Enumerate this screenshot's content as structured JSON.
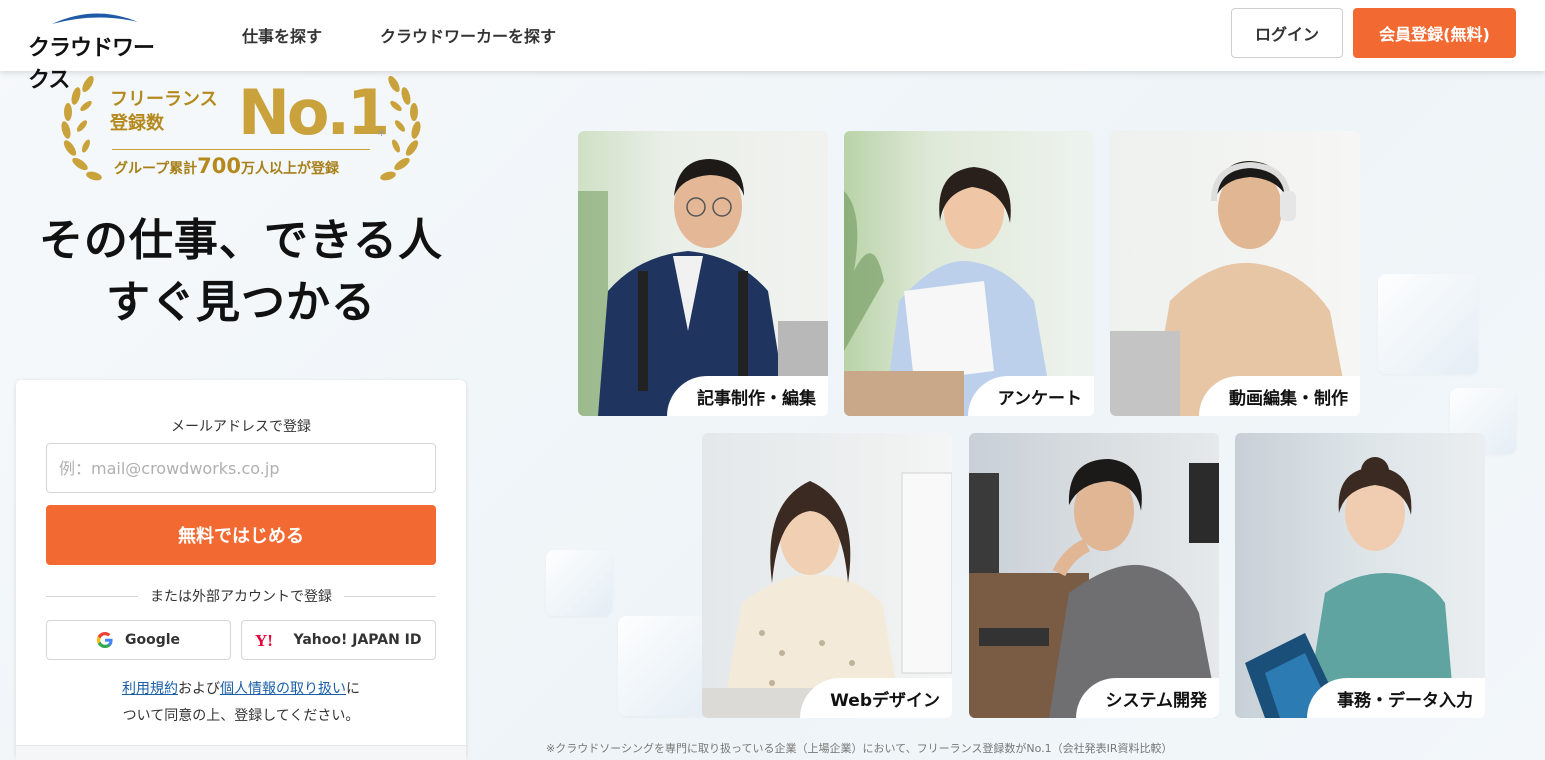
{
  "header": {
    "logo_text": "クラウドワークス",
    "nav": [
      "仕事を探す",
      "クラウドワーカーを探す"
    ],
    "login_label": "ログイン",
    "register_label": "会員登録(無料)"
  },
  "award": {
    "line1": "フリーランス",
    "line2": "登録数",
    "title": "No.1",
    "asterisk": "*",
    "sub_prefix": "グループ累計",
    "sub_number": "700",
    "sub_suffix": "万人以上が登録"
  },
  "headline": {
    "line1": "その仕事、できる人",
    "line2": "すぐ見つかる"
  },
  "register_card": {
    "title": "メールアドレスで登録",
    "email_placeholder": "例：mail@crowdworks.co.jp",
    "email_value": "",
    "start_button": "無料ではじめる",
    "or_text": "または外部アカウントで登録",
    "google_label": "Google",
    "yahoo_label": "Yahoo! JAPAN ID",
    "terms_link": "利用規約",
    "terms_and": "および",
    "privacy_link": "個人情報の取り扱い",
    "terms_tail1": "に",
    "terms_tail2": "ついて同意の上、登録してください。"
  },
  "categories": [
    {
      "label": "記事制作・編集"
    },
    {
      "label": "アンケート"
    },
    {
      "label": "動画編集・制作"
    },
    {
      "label": "Webデザイン"
    },
    {
      "label": "システム開発"
    },
    {
      "label": "事務・データ入力"
    }
  ],
  "footnote": "※クラウドソーシングを専門に取り扱っている企業（上場企業）において、フリーランス登録数がNo.1（会社発表IR資料比較）",
  "colors": {
    "accent": "#f26a32",
    "gold": "#c9a23b",
    "link": "#1a5fa8",
    "logo_blue": "#1f5aa8"
  }
}
